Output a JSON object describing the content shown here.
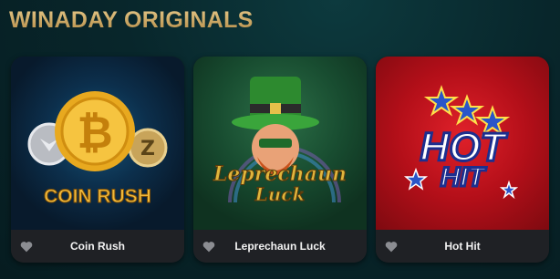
{
  "section": {
    "title": "WINADAY ORIGINALS"
  },
  "games": [
    {
      "name": "Coin Rush",
      "logo_words": [
        "COIN",
        "RUSH"
      ],
      "accent": "#f0b93a"
    },
    {
      "name": "Leprechaun Luck",
      "logo_words": [
        "Leprechaun",
        "Luck"
      ],
      "accent": "#e0b53c"
    },
    {
      "name": "Hot Hit",
      "logo_words": [
        "HOT",
        "HIT"
      ],
      "accent": "#e3232b"
    }
  ],
  "icons": {
    "favorite": "heart-icon"
  }
}
